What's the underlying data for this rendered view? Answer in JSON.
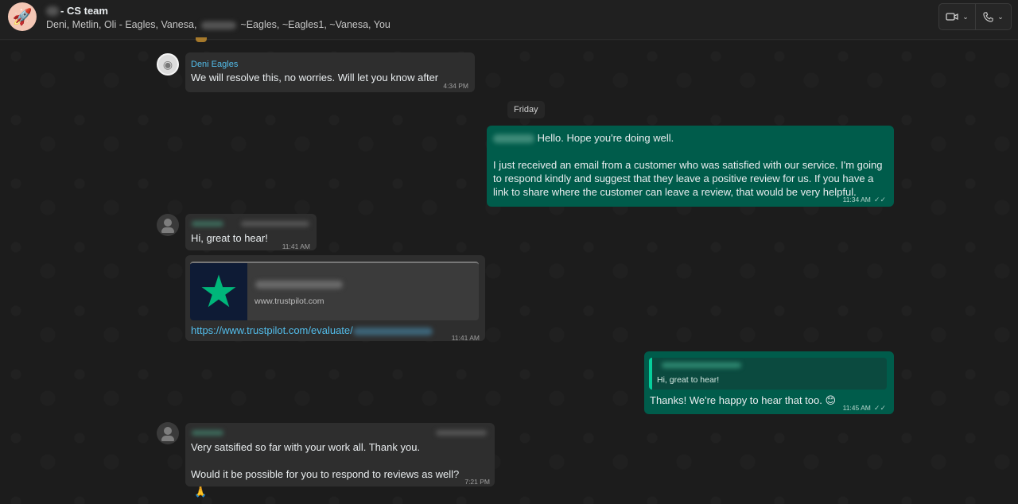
{
  "header": {
    "title": "- CS team",
    "members_part1": "Deni, Metlin, Oli - Eagles, Vanesa,",
    "members_part2": "~Eagles, ~Eagles1, ~Vanesa, You",
    "avatar_icon": "rocket-icon",
    "video_icon": "video-camera-icon",
    "call_icon": "phone-icon"
  },
  "date_chip": "Friday",
  "messages": [
    {
      "sender": "Deni Eagles",
      "text": "We will resolve this, no worries. Will let you know after",
      "time": "4:34 PM"
    },
    {
      "greeting": "Hello. Hope you're doing well.",
      "text": "I just received an email from a customer who was satisfied with our service. I'm going to respond kindly and suggest that they leave a positive review for us. If you have a link to share where the customer can leave a review, that would be very helpful.",
      "time": "11:34 AM"
    },
    {
      "text": "Hi, great to hear!",
      "time": "11:41 AM"
    },
    {
      "preview_domain": "www.trustpilot.com",
      "link": "https://www.trustpilot.com/evaluate/",
      "time": "11:41 AM"
    },
    {
      "quoted_text": "Hi, great to hear!",
      "text": "Thanks! We're happy to hear that too. 😊",
      "time": "11:45 AM"
    },
    {
      "text1": "Very satsified so far with your work all. Thank you.",
      "text2": "Would it be possible for you to respond to reviews as well?",
      "time": "7:21 PM",
      "reaction": "🙏"
    }
  ]
}
